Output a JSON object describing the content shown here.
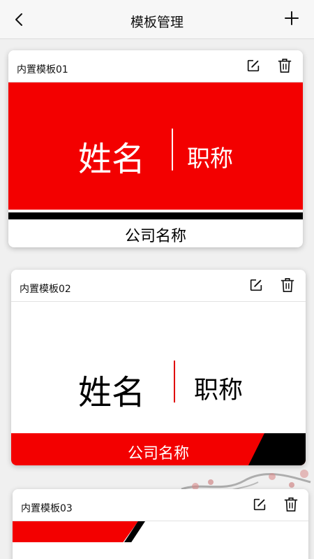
{
  "header": {
    "title": "模板管理",
    "back_icon": "back-chevron-icon",
    "add_icon": "plus-icon"
  },
  "templates": [
    {
      "label": "内置模板01",
      "name_text": "姓名",
      "title_text": "职称",
      "company_text": "公司名称",
      "colors": {
        "primary": "#f30000",
        "secondary": "#000000"
      }
    },
    {
      "label": "内置模板02",
      "name_text": "姓名",
      "title_text": "职称",
      "company_text": "公司名称",
      "colors": {
        "primary": "#f30000",
        "secondary": "#000000"
      }
    },
    {
      "label": "内置模板03",
      "colors": {
        "primary": "#f30000",
        "secondary": "#000000"
      }
    }
  ],
  "card_actions": {
    "edit_icon": "edit-icon",
    "delete_icon": "trash-icon"
  }
}
